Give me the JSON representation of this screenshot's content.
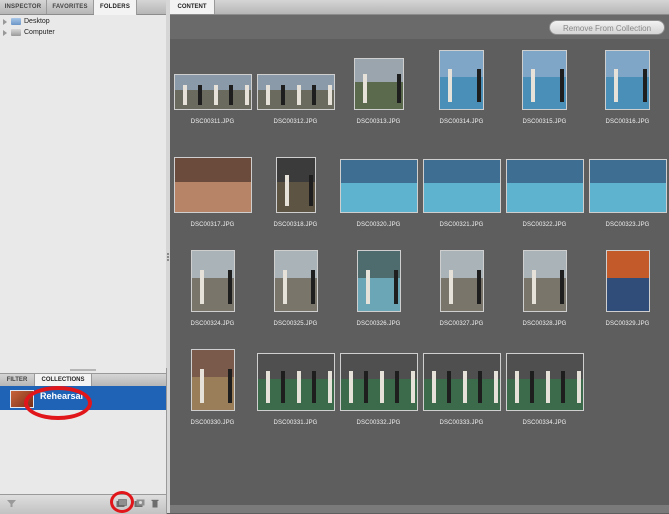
{
  "left_panel": {
    "tabs": [
      "INSPECTOR",
      "FAVORITES",
      "FOLDERS"
    ],
    "active_tab": "FOLDERS",
    "tree": [
      {
        "label": "Desktop",
        "icon": "folder-icon"
      },
      {
        "label": "Computer",
        "icon": "computer-icon"
      }
    ],
    "bottom_tabs": [
      "FILTER",
      "COLLECTIONS"
    ],
    "active_bottom_tab": "COLLECTIONS",
    "collection": {
      "label": "Rehearsal",
      "selected": true
    },
    "footer_icons": [
      "filter-icon",
      "new-collection-icon",
      "new-smart-collection-icon",
      "delete-icon"
    ]
  },
  "content_panel": {
    "tab": "CONTENT",
    "remove_button": "Remove From Collection",
    "files": [
      {
        "name": "DSC00311.JPG",
        "kind": "group"
      },
      {
        "name": "DSC00312.JPG",
        "kind": "group"
      },
      {
        "name": "DSC00313.JPG",
        "kind": "group-tall"
      },
      {
        "name": "DSC00314.JPG",
        "kind": "portrait-pool"
      },
      {
        "name": "DSC00315.JPG",
        "kind": "portrait-pool"
      },
      {
        "name": "DSC00316.JPG",
        "kind": "portrait-pool"
      },
      {
        "name": "DSC00317.JPG",
        "kind": "hands"
      },
      {
        "name": "DSC00318.JPG",
        "kind": "portrait-dark"
      },
      {
        "name": "DSC00320.JPG",
        "kind": "pool"
      },
      {
        "name": "DSC00321.JPG",
        "kind": "pool"
      },
      {
        "name": "DSC00322.JPG",
        "kind": "pool"
      },
      {
        "name": "DSC00323.JPG",
        "kind": "pool"
      },
      {
        "name": "DSC00324.JPG",
        "kind": "portrait-court"
      },
      {
        "name": "DSC00325.JPG",
        "kind": "portrait-court"
      },
      {
        "name": "DSC00326.JPG",
        "kind": "portrait-pool-play"
      },
      {
        "name": "DSC00327.JPG",
        "kind": "portrait-court"
      },
      {
        "name": "DSC00328.JPG",
        "kind": "portrait-court"
      },
      {
        "name": "DSC00329.JPG",
        "kind": "portrait-person"
      },
      {
        "name": "DSC00330.JPG",
        "kind": "portrait-party"
      },
      {
        "name": "DSC00331.JPG",
        "kind": "party"
      },
      {
        "name": "DSC00332.JPG",
        "kind": "party"
      },
      {
        "name": "DSC00333.JPG",
        "kind": "party"
      },
      {
        "name": "DSC00334.JPG",
        "kind": "party"
      }
    ]
  },
  "colors": {
    "selection": "#1f63b6",
    "highlight_ring": "#e0161b",
    "content_bg": "#5e5e5e"
  }
}
